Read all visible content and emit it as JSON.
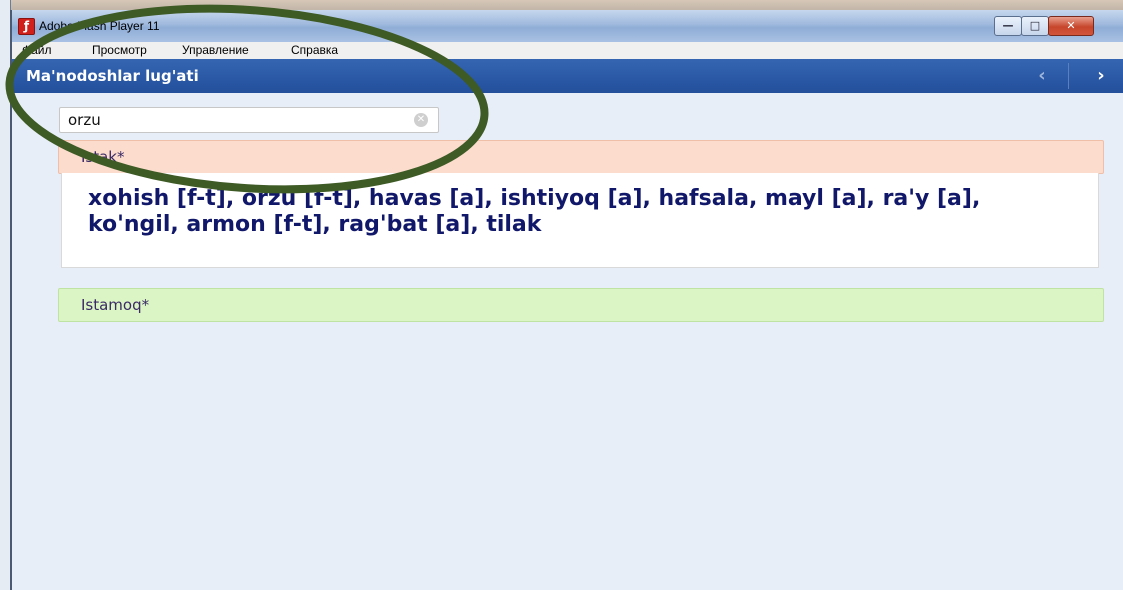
{
  "window": {
    "title": "Adobe Flash Player 11",
    "app_icon": "flash-icon",
    "buttons": {
      "minimize": "—",
      "maximize": "□",
      "close": "✕"
    }
  },
  "menu": {
    "items": [
      "Файл",
      "Просмотр",
      "Управление",
      "Справка"
    ]
  },
  "header": {
    "title": "Ma'nodoshlar lug'ati",
    "prev_icon": "‹",
    "next_icon": "›"
  },
  "search": {
    "value": "orzu",
    "clear_icon": "✕"
  },
  "results": [
    {
      "word": "Istak*",
      "definition": "xohish [f-t], orzu [f-t], havas [a], ishtiyoq [a], hafsala, mayl [a], ra'y [a], ko'ngil, armon [f-t], rag'bat [a], tilak",
      "color": "#fbdccd"
    },
    {
      "word": "Istamoq*",
      "color": "#dcf5c5"
    }
  ],
  "colors": {
    "header": "#2a58a5",
    "annotation": "#3e5a25"
  }
}
